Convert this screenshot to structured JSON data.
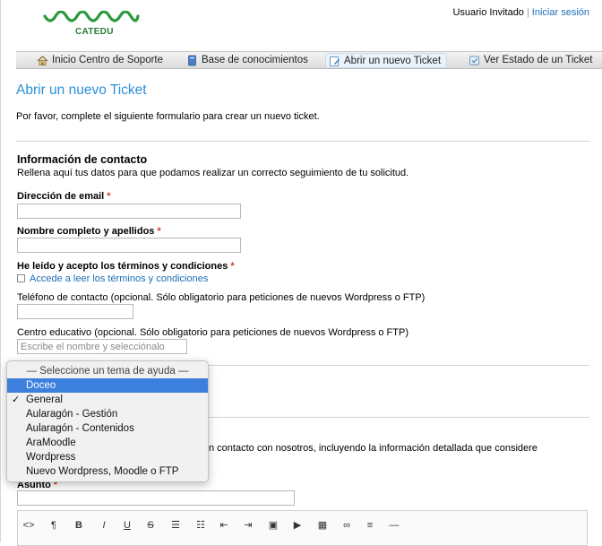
{
  "brand": {
    "logo_text": "CATEDU",
    "logo_color": "#2b9a3a"
  },
  "userbar": {
    "user": "Usuario Invitado",
    "separator": "|",
    "login_link": "Iniciar sesión"
  },
  "nav": {
    "items": [
      {
        "label": "Inicio Centro de Soporte",
        "icon": "home-icon"
      },
      {
        "label": "Base de conocimientos",
        "icon": "book-icon"
      },
      {
        "label": "Abrir un nuevo Ticket",
        "icon": "new-ticket-icon",
        "active": true
      },
      {
        "label": "Ver Estado de un Ticket",
        "icon": "ticket-status-icon"
      }
    ]
  },
  "page": {
    "title": "Abrir un nuevo Ticket",
    "intro": "Por favor, complete el siguiente formulario para crear un nuevo ticket."
  },
  "contact": {
    "title": "Información de contacto",
    "description": "Rellena aquí tus datos para que podamos realizar un correcto seguimiento de tu solicitud.",
    "email_label": "Dirección de email",
    "name_label": "Nombre completo y apellidos",
    "terms_label": "He leído y acepto los términos y condiciones",
    "terms_link": "Accede a leer los términos y condiciones",
    "phone_label": "Teléfono de contacto (opcional. Sólo obligatorio para peticiones de nuevos Wordpress o FTP)",
    "center_label": "Centro educativo (opcional. Sólo obligatorio para peticiones de nuevos Wordpress o FTP)",
    "center_placeholder": "Escribe el nombre y selecciónalo",
    "required_mark": "*"
  },
  "help_topic": {
    "placeholder": "— Seleccione un tema de ayuda —",
    "options": [
      "Doceo",
      "General",
      "Aularagón - Gestión",
      "Aularagón - Contenidos",
      "AraMoodle",
      "Wordpress",
      "Nuevo Wordpress, Moodle o FTP"
    ],
    "highlighted": "Doceo",
    "selected": "General",
    "check_mark": "✓"
  },
  "ticket": {
    "partial_desc": "n contacto con nosotros, incluyendo la información detallada que considere",
    "subject_label": "Asunto"
  },
  "editor": {
    "toolbar": [
      {
        "icon": "code-icon",
        "glyph": "<>"
      },
      {
        "icon": "paragraph-icon",
        "glyph": "¶"
      },
      {
        "icon": "bold-icon",
        "glyph": "B"
      },
      {
        "icon": "italic-icon",
        "glyph": "I"
      },
      {
        "icon": "underline-icon",
        "glyph": "U"
      },
      {
        "icon": "strikethrough-icon",
        "glyph": "S"
      },
      {
        "icon": "unordered-list-icon",
        "glyph": "☰"
      },
      {
        "icon": "ordered-list-icon",
        "glyph": "☷"
      },
      {
        "icon": "outdent-icon",
        "glyph": "⇤"
      },
      {
        "icon": "indent-icon",
        "glyph": "⇥"
      },
      {
        "icon": "image-icon",
        "glyph": "▣"
      },
      {
        "icon": "video-icon",
        "glyph": "▶"
      },
      {
        "icon": "table-icon",
        "glyph": "▦"
      },
      {
        "icon": "link-icon",
        "glyph": "∞"
      },
      {
        "icon": "align-icon",
        "glyph": "≡"
      },
      {
        "icon": "horizontal-rule-icon",
        "glyph": "—"
      }
    ]
  }
}
